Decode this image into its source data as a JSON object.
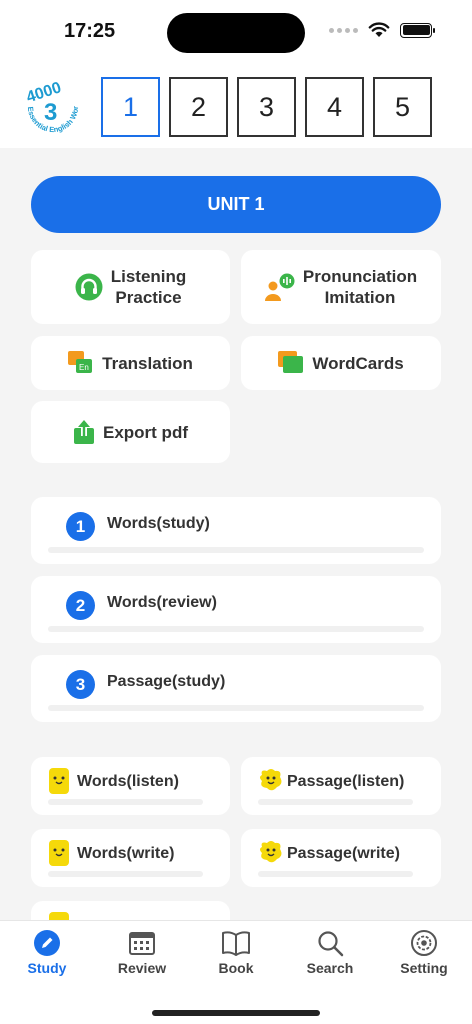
{
  "status_bar": {
    "time": "17:25"
  },
  "header": {
    "logo": {
      "line1": "4000",
      "line2": "3",
      "arc_text": "Essential English Words"
    },
    "unit_tabs": [
      "1",
      "2",
      "3",
      "4",
      "5"
    ],
    "active_unit": "1"
  },
  "main": {
    "unit_button": "UNIT 1",
    "features": {
      "listening": "Listening\nPractice",
      "pronunciation": "Pronunciation\nImitation",
      "translation": "Translation",
      "wordcards": "WordCards",
      "export": "Export pdf",
      "translation_badge": "En"
    },
    "study_items": [
      {
        "num": "1",
        "label": "Words(study)"
      },
      {
        "num": "2",
        "label": "Words(review)"
      },
      {
        "num": "3",
        "label": "Passage(study)"
      }
    ],
    "practice_items": [
      {
        "label": "Words(listen)"
      },
      {
        "label": "Passage(listen)"
      },
      {
        "label": "Words(write)"
      },
      {
        "label": "Passage(write)"
      }
    ]
  },
  "tab_bar": {
    "tabs": [
      {
        "label": "Study",
        "icon": "pencil-icon"
      },
      {
        "label": "Review",
        "icon": "calendar-icon"
      },
      {
        "label": "Book",
        "icon": "book-icon"
      },
      {
        "label": "Search",
        "icon": "search-icon"
      },
      {
        "label": "Setting",
        "icon": "gear-icon"
      }
    ],
    "active": "Study"
  },
  "colors": {
    "accent": "#1a6fe8",
    "logo": "#1d9bd1",
    "green": "#3bb54a",
    "orange": "#f39a1e",
    "yellow": "#f5d90a"
  }
}
